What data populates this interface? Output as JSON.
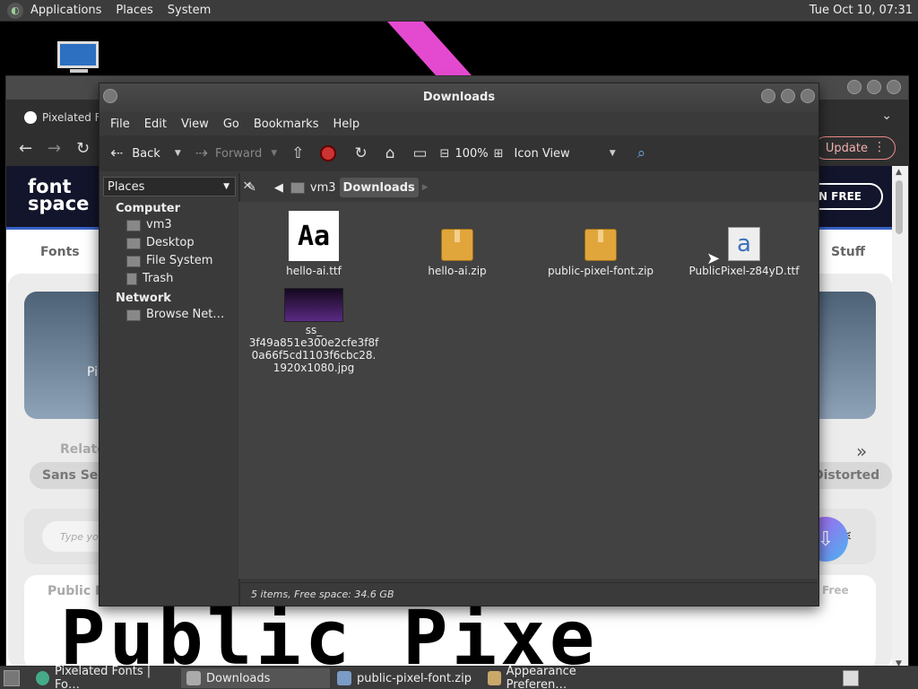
{
  "top_panel": {
    "menus": [
      "Applications",
      "Places",
      "System"
    ],
    "clock": "Tue Oct 10, 07:31"
  },
  "browser": {
    "tab_title": "Pixelated F",
    "update_label": "Update",
    "fontspace": {
      "logo_line1": "font",
      "logo_line2": "space",
      "join_label": "OIN FREE",
      "nav_fonts": "Fonts",
      "nav_stuff": "Stuff",
      "hero_text": "Pi",
      "related": "Relate",
      "pill_left": "Sans Seri",
      "pill_right": "Distorted",
      "type_placeholder": "Type you",
      "font_name": "Public Pi",
      "free_label": "Free",
      "sample_text": "Public Pixe"
    }
  },
  "file_manager": {
    "title": "Downloads",
    "menu": [
      "File",
      "Edit",
      "View",
      "Go",
      "Bookmarks",
      "Help"
    ],
    "toolbar": {
      "back": "Back",
      "forward": "Forward",
      "zoom": "100%",
      "view_mode": "Icon View"
    },
    "sidebar": {
      "header": "Places",
      "sections": [
        {
          "title": "Computer",
          "items": [
            "vm3",
            "Desktop",
            "File System",
            "Trash"
          ]
        },
        {
          "title": "Network",
          "items": [
            "Browse Net…"
          ]
        }
      ]
    },
    "path": {
      "parent": "vm3",
      "current": "Downloads"
    },
    "files": [
      {
        "name": "hello-ai.ttf",
        "icon": "font-preview-icon"
      },
      {
        "name": "hello-ai.zip",
        "icon": "archive-icon"
      },
      {
        "name": "public-pixel-font.zip",
        "icon": "archive-icon"
      },
      {
        "name": "PublicPixel-z84yD.ttf",
        "icon": "font-file-icon"
      },
      {
        "name_lines": [
          "ss_",
          "3f49a851e300e2cfe3f8f",
          "0a66f5cd1103f6cbc28.",
          "1920x1080.jpg"
        ],
        "icon": "image-thumbnail-icon"
      }
    ],
    "status": "5 items, Free space: 34.6 GB"
  },
  "taskbar": {
    "tasks": [
      "Pixelated Fonts | Fo…",
      "Downloads",
      "public-pixel-font.zip",
      "Appearance Preferen…"
    ]
  },
  "colors": {
    "panel": "#3c3c3c",
    "fm_bg": "#424242",
    "accent_pink": "#e44ad0"
  }
}
